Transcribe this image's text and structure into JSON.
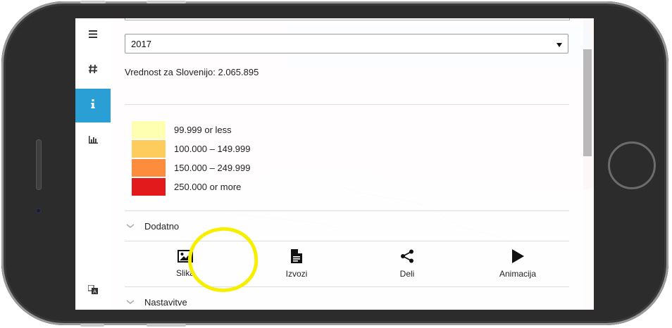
{
  "sidebar": {
    "items": [
      {
        "name": "menu",
        "icon": "menu-icon",
        "active": false
      },
      {
        "name": "hash",
        "icon": "hash-icon",
        "active": false
      },
      {
        "name": "info",
        "icon": "info-icon",
        "active": true
      },
      {
        "name": "chart",
        "icon": "bar-chart-icon",
        "active": false
      }
    ],
    "bottom_icon": "translate-icon"
  },
  "panel": {
    "year_select": {
      "value": "2017"
    },
    "value_text": "Vrednost za Slovenijo: 2.065.895",
    "legend": [
      {
        "label": "99.999 or less",
        "color": "#ffffb2"
      },
      {
        "label": "100.000 – 149.999",
        "color": "#fecc5c"
      },
      {
        "label": "150.000 – 249.999",
        "color": "#fd8d3c"
      },
      {
        "label": "250.000 or more",
        "color": "#e31a1c"
      }
    ],
    "section_dodatno": "Dodatno",
    "actions": [
      {
        "label": "Slika",
        "icon": "image-icon"
      },
      {
        "label": "Izvozi",
        "icon": "document-icon"
      },
      {
        "label": "Deli",
        "icon": "share-icon"
      },
      {
        "label": "Animacija",
        "icon": "play-icon"
      }
    ],
    "section_nastavitve": "Nastavitve"
  },
  "colors": {
    "accent": "#2a9fd6",
    "highlight": "#f6f000"
  }
}
